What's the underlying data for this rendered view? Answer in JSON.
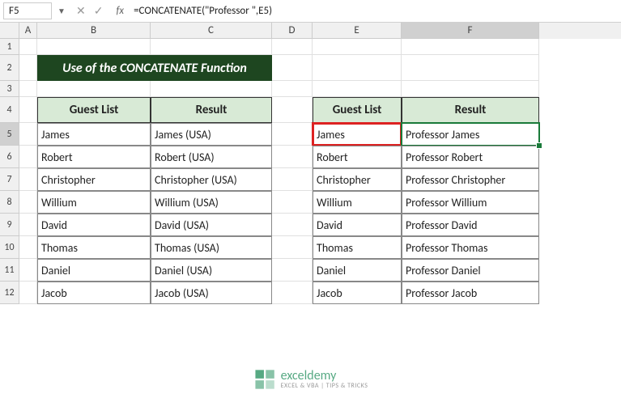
{
  "namebox": "F5",
  "formula": "=CONCATENATE(\"Professor \",E5)",
  "cols": [
    "A",
    "B",
    "C",
    "D",
    "E",
    "F"
  ],
  "rows": [
    "1",
    "2",
    "3",
    "4",
    "5",
    "6",
    "7",
    "8",
    "9",
    "10",
    "11",
    "12"
  ],
  "title": "Use of the CONCATENATE Function",
  "table1": {
    "h1": "Guest List",
    "h2": "Result",
    "rows": [
      {
        "g": "James",
        "r": "James (USA)"
      },
      {
        "g": "Robert",
        "r": "Robert (USA)"
      },
      {
        "g": "Christopher",
        "r": "Christopher (USA)"
      },
      {
        "g": "Willium",
        "r": "Willium (USA)"
      },
      {
        "g": "David",
        "r": "David (USA)"
      },
      {
        "g": "Thomas",
        "r": "Thomas (USA)"
      },
      {
        "g": "Daniel",
        "r": "Daniel (USA)"
      },
      {
        "g": "Jacob",
        "r": "Jacob (USA)"
      }
    ]
  },
  "table2": {
    "h1": "Guest List",
    "h2": "Result",
    "rows": [
      {
        "g": "James",
        "r": "Professor James"
      },
      {
        "g": "Robert",
        "r": "Professor Robert"
      },
      {
        "g": "Christopher",
        "r": "Professor Christopher"
      },
      {
        "g": "Willium",
        "r": "Professor Willium"
      },
      {
        "g": "David",
        "r": "Professor David"
      },
      {
        "g": "Thomas",
        "r": "Professor Thomas"
      },
      {
        "g": "Daniel",
        "r": "Professor Daniel"
      },
      {
        "g": "Jacob",
        "r": "Professor Jacob"
      }
    ]
  },
  "watermark": {
    "title": "exceldemy",
    "sub": "EXCEL & VBA | TIPS & TRICKS"
  }
}
